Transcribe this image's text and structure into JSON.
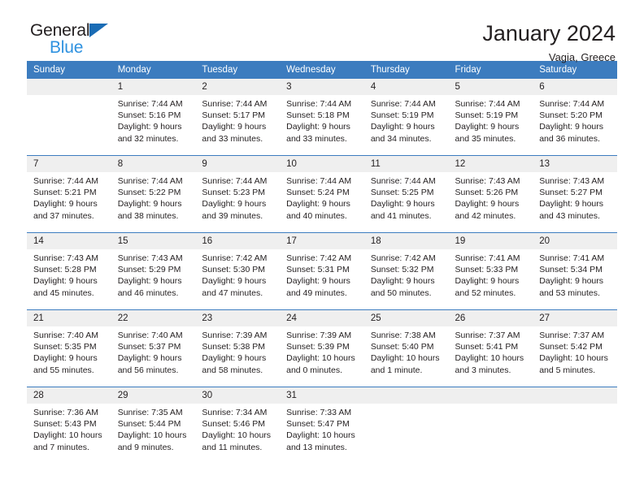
{
  "brand": {
    "name_top": "General",
    "name_bottom": "Blue",
    "triangle_icon": "blue-triangle-logo-mark",
    "accent_color": "#1a6cb5",
    "accent_color_light": "#2f92e0"
  },
  "header": {
    "title": "January 2024",
    "subtitle": "Vagia, Greece"
  },
  "theme": {
    "header_row_bg": "#3c7cbf",
    "daynum_bg": "#efefef",
    "cell_bg": "#ffffff",
    "text_color": "#231f20"
  },
  "columns": [
    "Sunday",
    "Monday",
    "Tuesday",
    "Wednesday",
    "Thursday",
    "Friday",
    "Saturday"
  ],
  "weeks": [
    {
      "days": [
        {
          "num": "",
          "sunrise": "",
          "sunset": "",
          "daylight1": "",
          "daylight2": ""
        },
        {
          "num": "1",
          "sunrise": "Sunrise: 7:44 AM",
          "sunset": "Sunset: 5:16 PM",
          "daylight1": "Daylight: 9 hours",
          "daylight2": "and 32 minutes."
        },
        {
          "num": "2",
          "sunrise": "Sunrise: 7:44 AM",
          "sunset": "Sunset: 5:17 PM",
          "daylight1": "Daylight: 9 hours",
          "daylight2": "and 33 minutes."
        },
        {
          "num": "3",
          "sunrise": "Sunrise: 7:44 AM",
          "sunset": "Sunset: 5:18 PM",
          "daylight1": "Daylight: 9 hours",
          "daylight2": "and 33 minutes."
        },
        {
          "num": "4",
          "sunrise": "Sunrise: 7:44 AM",
          "sunset": "Sunset: 5:19 PM",
          "daylight1": "Daylight: 9 hours",
          "daylight2": "and 34 minutes."
        },
        {
          "num": "5",
          "sunrise": "Sunrise: 7:44 AM",
          "sunset": "Sunset: 5:19 PM",
          "daylight1": "Daylight: 9 hours",
          "daylight2": "and 35 minutes."
        },
        {
          "num": "6",
          "sunrise": "Sunrise: 7:44 AM",
          "sunset": "Sunset: 5:20 PM",
          "daylight1": "Daylight: 9 hours",
          "daylight2": "and 36 minutes."
        }
      ]
    },
    {
      "days": [
        {
          "num": "7",
          "sunrise": "Sunrise: 7:44 AM",
          "sunset": "Sunset: 5:21 PM",
          "daylight1": "Daylight: 9 hours",
          "daylight2": "and 37 minutes."
        },
        {
          "num": "8",
          "sunrise": "Sunrise: 7:44 AM",
          "sunset": "Sunset: 5:22 PM",
          "daylight1": "Daylight: 9 hours",
          "daylight2": "and 38 minutes."
        },
        {
          "num": "9",
          "sunrise": "Sunrise: 7:44 AM",
          "sunset": "Sunset: 5:23 PM",
          "daylight1": "Daylight: 9 hours",
          "daylight2": "and 39 minutes."
        },
        {
          "num": "10",
          "sunrise": "Sunrise: 7:44 AM",
          "sunset": "Sunset: 5:24 PM",
          "daylight1": "Daylight: 9 hours",
          "daylight2": "and 40 minutes."
        },
        {
          "num": "11",
          "sunrise": "Sunrise: 7:44 AM",
          "sunset": "Sunset: 5:25 PM",
          "daylight1": "Daylight: 9 hours",
          "daylight2": "and 41 minutes."
        },
        {
          "num": "12",
          "sunrise": "Sunrise: 7:43 AM",
          "sunset": "Sunset: 5:26 PM",
          "daylight1": "Daylight: 9 hours",
          "daylight2": "and 42 minutes."
        },
        {
          "num": "13",
          "sunrise": "Sunrise: 7:43 AM",
          "sunset": "Sunset: 5:27 PM",
          "daylight1": "Daylight: 9 hours",
          "daylight2": "and 43 minutes."
        }
      ]
    },
    {
      "days": [
        {
          "num": "14",
          "sunrise": "Sunrise: 7:43 AM",
          "sunset": "Sunset: 5:28 PM",
          "daylight1": "Daylight: 9 hours",
          "daylight2": "and 45 minutes."
        },
        {
          "num": "15",
          "sunrise": "Sunrise: 7:43 AM",
          "sunset": "Sunset: 5:29 PM",
          "daylight1": "Daylight: 9 hours",
          "daylight2": "and 46 minutes."
        },
        {
          "num": "16",
          "sunrise": "Sunrise: 7:42 AM",
          "sunset": "Sunset: 5:30 PM",
          "daylight1": "Daylight: 9 hours",
          "daylight2": "and 47 minutes."
        },
        {
          "num": "17",
          "sunrise": "Sunrise: 7:42 AM",
          "sunset": "Sunset: 5:31 PM",
          "daylight1": "Daylight: 9 hours",
          "daylight2": "and 49 minutes."
        },
        {
          "num": "18",
          "sunrise": "Sunrise: 7:42 AM",
          "sunset": "Sunset: 5:32 PM",
          "daylight1": "Daylight: 9 hours",
          "daylight2": "and 50 minutes."
        },
        {
          "num": "19",
          "sunrise": "Sunrise: 7:41 AM",
          "sunset": "Sunset: 5:33 PM",
          "daylight1": "Daylight: 9 hours",
          "daylight2": "and 52 minutes."
        },
        {
          "num": "20",
          "sunrise": "Sunrise: 7:41 AM",
          "sunset": "Sunset: 5:34 PM",
          "daylight1": "Daylight: 9 hours",
          "daylight2": "and 53 minutes."
        }
      ]
    },
    {
      "days": [
        {
          "num": "21",
          "sunrise": "Sunrise: 7:40 AM",
          "sunset": "Sunset: 5:35 PM",
          "daylight1": "Daylight: 9 hours",
          "daylight2": "and 55 minutes."
        },
        {
          "num": "22",
          "sunrise": "Sunrise: 7:40 AM",
          "sunset": "Sunset: 5:37 PM",
          "daylight1": "Daylight: 9 hours",
          "daylight2": "and 56 minutes."
        },
        {
          "num": "23",
          "sunrise": "Sunrise: 7:39 AM",
          "sunset": "Sunset: 5:38 PM",
          "daylight1": "Daylight: 9 hours",
          "daylight2": "and 58 minutes."
        },
        {
          "num": "24",
          "sunrise": "Sunrise: 7:39 AM",
          "sunset": "Sunset: 5:39 PM",
          "daylight1": "Daylight: 10 hours",
          "daylight2": "and 0 minutes."
        },
        {
          "num": "25",
          "sunrise": "Sunrise: 7:38 AM",
          "sunset": "Sunset: 5:40 PM",
          "daylight1": "Daylight: 10 hours",
          "daylight2": "and 1 minute."
        },
        {
          "num": "26",
          "sunrise": "Sunrise: 7:37 AM",
          "sunset": "Sunset: 5:41 PM",
          "daylight1": "Daylight: 10 hours",
          "daylight2": "and 3 minutes."
        },
        {
          "num": "27",
          "sunrise": "Sunrise: 7:37 AM",
          "sunset": "Sunset: 5:42 PM",
          "daylight1": "Daylight: 10 hours",
          "daylight2": "and 5 minutes."
        }
      ]
    },
    {
      "days": [
        {
          "num": "28",
          "sunrise": "Sunrise: 7:36 AM",
          "sunset": "Sunset: 5:43 PM",
          "daylight1": "Daylight: 10 hours",
          "daylight2": "and 7 minutes."
        },
        {
          "num": "29",
          "sunrise": "Sunrise: 7:35 AM",
          "sunset": "Sunset: 5:44 PM",
          "daylight1": "Daylight: 10 hours",
          "daylight2": "and 9 minutes."
        },
        {
          "num": "30",
          "sunrise": "Sunrise: 7:34 AM",
          "sunset": "Sunset: 5:46 PM",
          "daylight1": "Daylight: 10 hours",
          "daylight2": "and 11 minutes."
        },
        {
          "num": "31",
          "sunrise": "Sunrise: 7:33 AM",
          "sunset": "Sunset: 5:47 PM",
          "daylight1": "Daylight: 10 hours",
          "daylight2": "and 13 minutes."
        },
        {
          "num": "",
          "sunrise": "",
          "sunset": "",
          "daylight1": "",
          "daylight2": ""
        },
        {
          "num": "",
          "sunrise": "",
          "sunset": "",
          "daylight1": "",
          "daylight2": ""
        },
        {
          "num": "",
          "sunrise": "",
          "sunset": "",
          "daylight1": "",
          "daylight2": ""
        }
      ]
    }
  ]
}
